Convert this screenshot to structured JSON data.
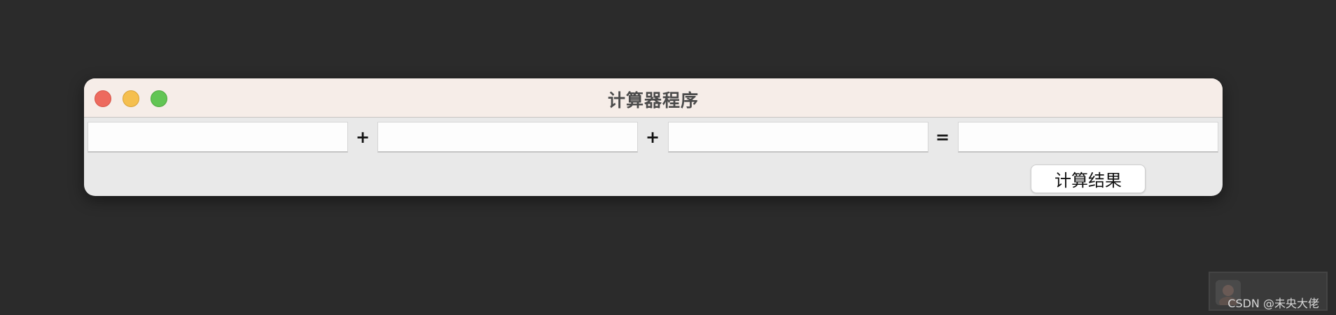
{
  "window": {
    "title": "计算器程序"
  },
  "form": {
    "field1_value": "",
    "field2_value": "",
    "field3_value": "",
    "result_value": "",
    "operator1": "+",
    "operator2": "+",
    "equals": "=",
    "calculate_label": "计算结果"
  },
  "traffic_lights": {
    "close_color": "#ed6a5e",
    "minimize_color": "#f5bf4f",
    "maximize_color": "#62c554"
  },
  "watermark": {
    "text": "CSDN @未央大佬",
    "avatar_icon": "avatar-icon"
  }
}
